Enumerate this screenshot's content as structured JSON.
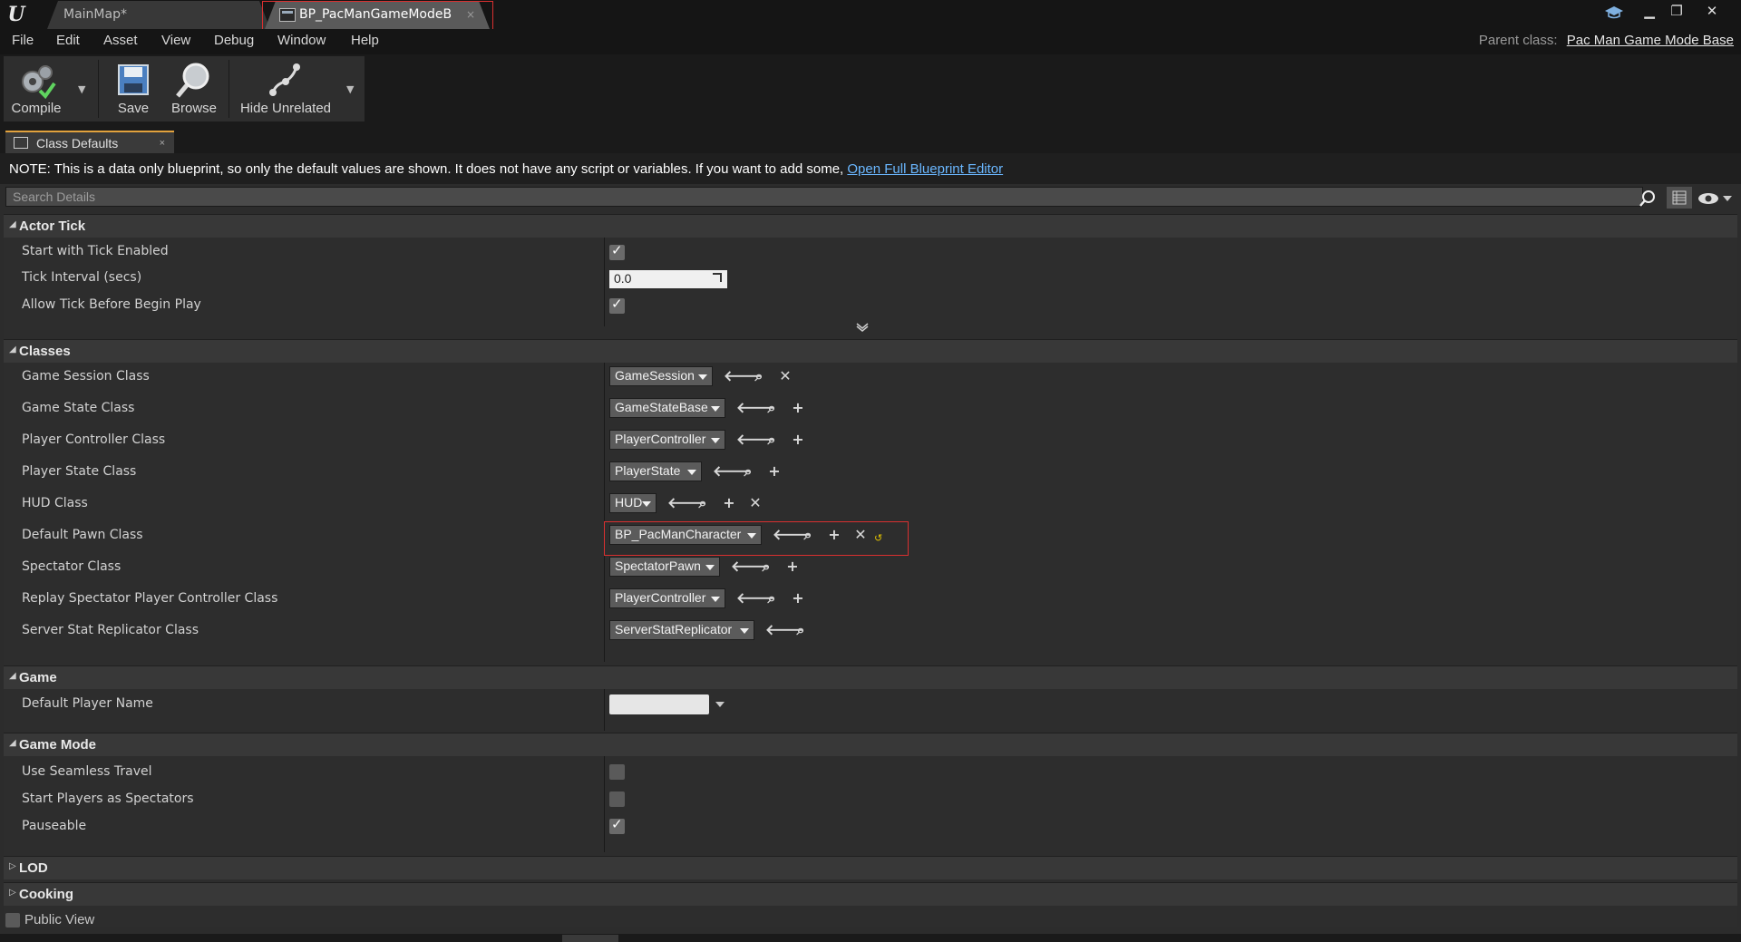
{
  "titlebar": {
    "tabs": [
      {
        "label": "MainMap*"
      },
      {
        "label": "BP_PacManGameModeB"
      }
    ],
    "tab_close_glyph": "×"
  },
  "menu": {
    "items": [
      "File",
      "Edit",
      "Asset",
      "View",
      "Debug",
      "Window",
      "Help"
    ],
    "parent_class_label": "Parent class:",
    "parent_class_value": "Pac Man Game Mode Base"
  },
  "toolbar": {
    "compile": "Compile",
    "save": "Save",
    "browse": "Browse",
    "hide_unrelated": "Hide Unrelated"
  },
  "details_tab": {
    "label": "Class Defaults",
    "close": "×"
  },
  "note": {
    "text": "NOTE: This is a data only blueprint, so only the default values are shown.  It does not have any script or variables.  If you want to add some, ",
    "link": "Open Full Blueprint Editor"
  },
  "search": {
    "placeholder": "Search Details"
  },
  "categories": {
    "actor_tick": {
      "title": "Actor Tick",
      "start_with_tick_enabled": {
        "label": "Start with Tick Enabled",
        "checked": true
      },
      "tick_interval": {
        "label": "Tick Interval (secs)",
        "value": "0.0"
      },
      "allow_tick_before_begin_play": {
        "label": "Allow Tick Before Begin Play",
        "checked": true
      }
    },
    "classes": {
      "title": "Classes",
      "rows": [
        {
          "label": "Game Session Class",
          "value": "GameSession"
        },
        {
          "label": "Game State Class",
          "value": "GameStateBase"
        },
        {
          "label": "Player Controller Class",
          "value": "PlayerController"
        },
        {
          "label": "Player State Class",
          "value": "PlayerState"
        },
        {
          "label": "HUD Class",
          "value": "HUD"
        },
        {
          "label": "Default Pawn Class",
          "value": "BP_PacManCharacter"
        },
        {
          "label": "Spectator Class",
          "value": "SpectatorPawn"
        },
        {
          "label": "Replay Spectator Player Controller Class",
          "value": "PlayerController"
        },
        {
          "label": "Server Stat Replicator Class",
          "value": "ServerStatReplicator"
        }
      ]
    },
    "game": {
      "title": "Game",
      "default_player_name": {
        "label": "Default Player Name",
        "value": ""
      }
    },
    "game_mode": {
      "title": "Game Mode",
      "use_seamless_travel": {
        "label": "Use Seamless Travel",
        "checked": false
      },
      "start_players_as_spectators": {
        "label": "Start Players as Spectators",
        "checked": false
      },
      "pauseable": {
        "label": "Pauseable",
        "checked": true
      }
    },
    "lod": {
      "title": "LOD"
    },
    "cooking": {
      "title": "Cooking"
    }
  },
  "public_view": {
    "label": "Public View",
    "checked": false
  },
  "colors": {
    "highlight": "#d93030",
    "link": "#6ab7ff",
    "accent": "#e2a23d"
  }
}
